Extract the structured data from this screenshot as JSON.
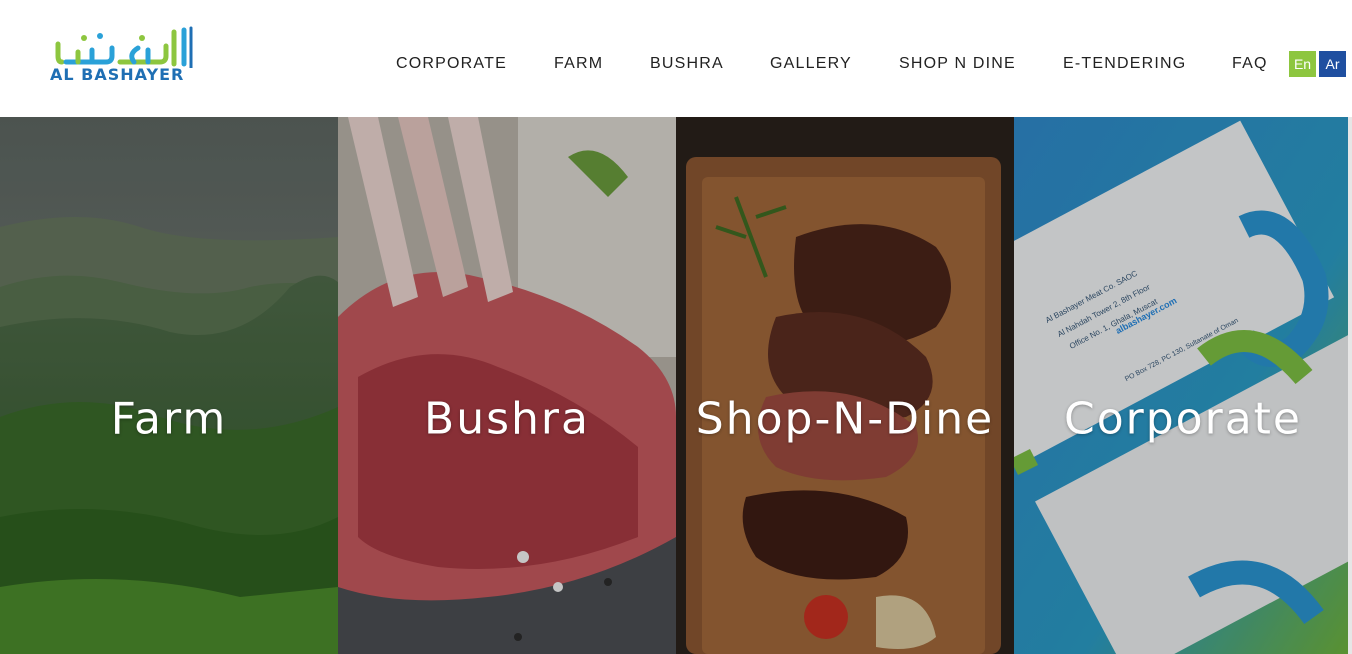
{
  "header": {
    "logo": {
      "arabic_mark": "البشائر",
      "text": "AL BASHAYER"
    },
    "nav": [
      {
        "label": "CORPORATE"
      },
      {
        "label": "FARM"
      },
      {
        "label": "BUSHRA"
      },
      {
        "label": "GALLERY"
      },
      {
        "label": "SHOP N DINE"
      },
      {
        "label": "E-TENDERING"
      },
      {
        "label": "FAQ"
      }
    ],
    "languages": [
      {
        "label": "En",
        "color": "#8dc63f"
      },
      {
        "label": "Ar",
        "color": "#1f4fa0"
      }
    ]
  },
  "panels": [
    {
      "label": "Farm",
      "image": "green-mountain-landscape"
    },
    {
      "label": "Bushra",
      "image": "raw-lamb-rack"
    },
    {
      "label": "Shop-N-Dine",
      "image": "grilled-steak-on-board"
    },
    {
      "label": "Corporate",
      "image": "business-cards"
    }
  ],
  "business_card": {
    "company": "Al Bashayer Meat Co. SAOC",
    "address_line1": "Al Nahdah Tower 2, 8th Floor",
    "address_line2": "Office No. 1, Ghala, Muscat",
    "website": "albashayer.com",
    "po_box": "PO Box 728, PC 130, Sultanate of Oman"
  }
}
